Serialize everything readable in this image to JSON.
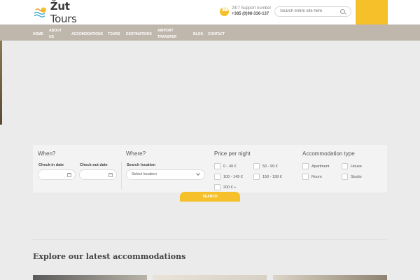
{
  "header": {
    "brand_bold": "Žut",
    "brand_rest": " Tours",
    "support_label": "24/7 Support number",
    "support_number": "+385 (0)98-336-137",
    "search_placeholder": "Search entire site here"
  },
  "nav": {
    "items": [
      {
        "label": "HOME"
      },
      {
        "label": "ABOUT US"
      },
      {
        "label": "ACCOMODATIONS"
      },
      {
        "label": "TOURS"
      },
      {
        "label": "DESTINATIONS"
      },
      {
        "label": "AIRPORT TRANSFER"
      },
      {
        "label": "BLOG"
      },
      {
        "label": "CONTACT"
      }
    ]
  },
  "search_panel": {
    "when": {
      "title": "When?",
      "checkin_label": "Check-in date",
      "checkout_label": "Check-out date"
    },
    "where": {
      "title": "Where?",
      "location_label": "Search location",
      "location_value": "Select location"
    },
    "price": {
      "title": "Price per night",
      "options": [
        "0 - 49 €",
        "50 - 99 €",
        "100 - 149 €",
        "150 - 199 €",
        "200 € +"
      ]
    },
    "type": {
      "title": "Accommodation type",
      "options": [
        "Apartment",
        "House",
        "Room",
        "Studio"
      ]
    },
    "button_label": "SEARCH"
  },
  "section": {
    "title": "Explore our latest accommodations"
  },
  "colors": {
    "accent": "#f6c02a",
    "nav_bg": "#bfb6ac"
  },
  "icons": {
    "phone": "phone-icon",
    "search": "search-icon",
    "calendar": "calendar-icon",
    "chevron": "chevron-down-icon"
  }
}
